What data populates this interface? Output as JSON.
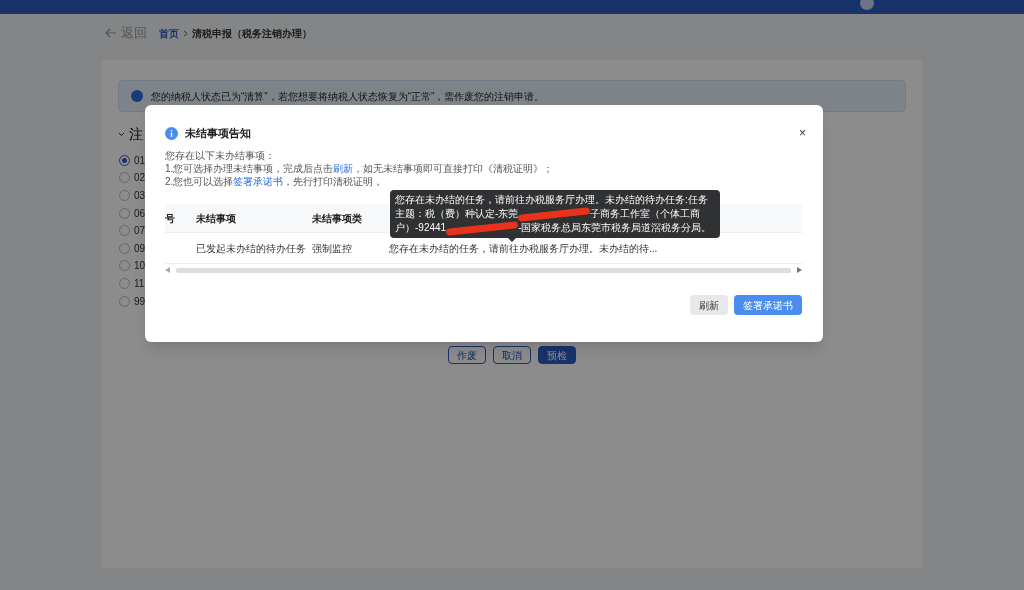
{
  "page": {
    "back_link": "返回",
    "breadcrumb": [
      {
        "label": "首页",
        "kind": "link"
      },
      {
        "label": "清税申报（税务注销办理）",
        "kind": "current"
      }
    ],
    "alert": "您的纳税人状态已为“清算”，若您想要将纳税人状态恢复为“正常”，需作废您的注销申请。",
    "section_title": "注",
    "options": [
      {
        "label": "01",
        "selected": true
      },
      {
        "label": "02",
        "selected": false
      },
      {
        "label": "03",
        "selected": false
      },
      {
        "label": "06",
        "selected": false
      },
      {
        "label": "07",
        "selected": false
      },
      {
        "label": "09",
        "selected": false
      },
      {
        "label": "10",
        "selected": false
      },
      {
        "label": "11",
        "selected": false
      },
      {
        "label": "99",
        "selected": false
      }
    ],
    "buttons": [
      {
        "label": "作废",
        "kind": "outline"
      },
      {
        "label": "取消",
        "kind": "outline"
      },
      {
        "label": "预检",
        "kind": "primary"
      }
    ]
  },
  "dialog": {
    "title": "未结事项告知",
    "close": "×",
    "intro": "您存在以下未办结事项：",
    "line1": [
      {
        "text": "1.您可选择办理未结事项，完成后点击",
        "kind": "text"
      },
      {
        "text": "刷新",
        "kind": "link"
      },
      {
        "text": "，如无未结事项即可直接打印《清税证明》；",
        "kind": "text"
      }
    ],
    "line2": [
      {
        "text": "2.您也可以选择",
        "kind": "text"
      },
      {
        "text": "签署承诺书",
        "kind": "link"
      },
      {
        "text": "，先行打印清税证明，",
        "kind": "text"
      }
    ],
    "table": {
      "columns": [
        "号",
        "未结事项",
        "未结事项类"
      ],
      "rows": [
        {
          "cells": [
            "",
            "已发起未办结的待办任务",
            "强制监控",
            "您存在未办结的任务，请前往办税服务厅办理。未办结的待..."
          ]
        }
      ]
    },
    "tooltip": [
      {
        "text": "您存在未办结的任务，请前往办税服务厅办理。未办结的待办任务:任务主题：税（费）种认定-东莞",
        "kind": "text"
      },
      {
        "kind": "redacted"
      },
      {
        "text": "子商务工作室（个体工商户）-92441",
        "kind": "text"
      },
      {
        "kind": "redacted"
      },
      {
        "text": "-国家税务总局东莞市税务局道滘税务分局。",
        "kind": "text"
      }
    ],
    "buttons": [
      {
        "label": "刷新",
        "kind": "default"
      },
      {
        "label": "签署承诺书",
        "kind": "primary"
      }
    ]
  }
}
